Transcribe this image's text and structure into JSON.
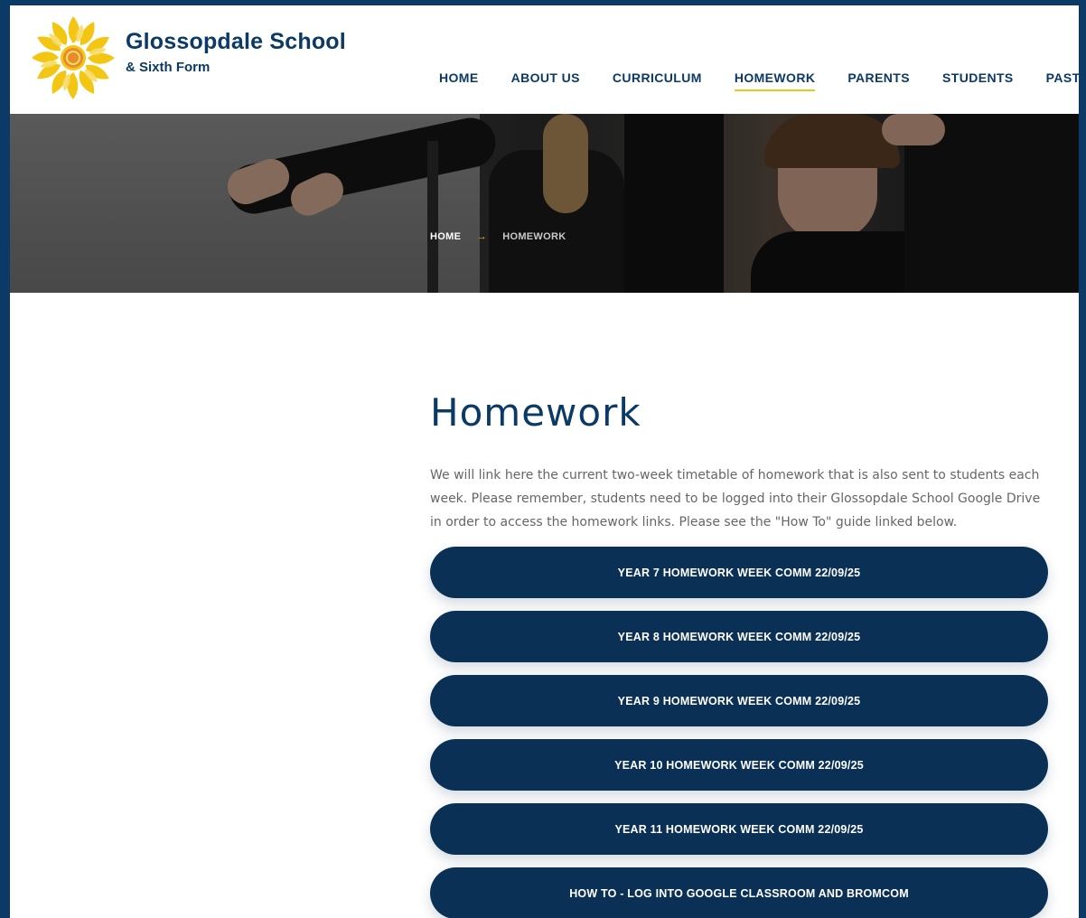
{
  "brand": {
    "name": "Glossopdale School",
    "sub": "& Sixth Form"
  },
  "nav": {
    "items": [
      "HOME",
      "ABOUT US",
      "CURRICULUM",
      "HOMEWORK",
      "PARENTS",
      "STUDENTS",
      "PASTO"
    ],
    "active": "HOMEWORK"
  },
  "breadcrumb": {
    "home": "HOME",
    "separator": "→",
    "current": "HOMEWORK"
  },
  "main": {
    "title": "Homework",
    "intro": "We will link here the current two-week timetable of homework that is also sent to students each week. Please remember, students need to be logged into their Glossopdale School Google Drive in order to access the homework links. Please see the \"How To\" guide linked below.",
    "buttons": [
      "YEAR 7 HOMEWORK WEEK COMM 22/09/25",
      "YEAR 8 HOMEWORK WEEK COMM 22/09/25",
      "YEAR 9 HOMEWORK WEEK COMM 22/09/25",
      "YEAR 10 HOMEWORK WEEK COMM 22/09/25",
      "YEAR 11 HOMEWORK WEEK COMM 22/09/25",
      "HOW TO - LOG INTO GOOGLE CLASSROOM AND BROMCOM"
    ]
  },
  "colors": {
    "outer": "#0b3a66",
    "brand_navy": "#0b3a66",
    "button_bg": "#0b3055",
    "accent_yellow": "#f0c419",
    "logo_orange": "#e98b2a"
  },
  "icons": {
    "logo": "sun-logo-icon",
    "breadcrumb_separator": "arrow-right-icon"
  }
}
